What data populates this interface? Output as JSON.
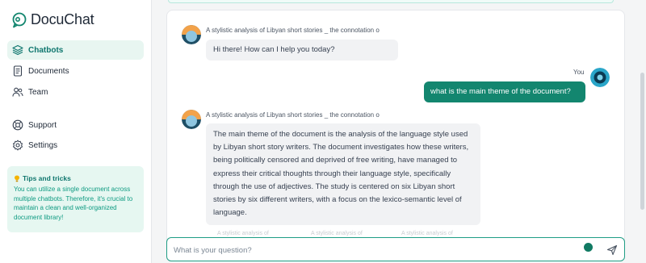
{
  "app": {
    "name": "DocuChat"
  },
  "sidebar": {
    "items": [
      {
        "label": "Chatbots",
        "icon": "layers-icon",
        "active": true
      },
      {
        "label": "Documents",
        "icon": "document-icon",
        "active": false
      },
      {
        "label": "Team",
        "icon": "team-icon",
        "active": false
      },
      {
        "label": "Support",
        "icon": "lifebuoy-icon",
        "active": false
      },
      {
        "label": "Settings",
        "icon": "gear-icon",
        "active": false
      }
    ],
    "tips": {
      "title": "Tips and tricks",
      "icon": "lightbulb-icon",
      "text": "You can utilize a single document across multiple chatbots. Therefore, it's crucial to maintain a clean and well-organized document library!"
    }
  },
  "chat": {
    "bot_name": "A stylistic analysis of Libyan short stories _ the connotation o",
    "user_name": "You",
    "messages": [
      {
        "role": "bot",
        "text": "Hi there! How can I help you today?"
      },
      {
        "role": "user",
        "text": "what is the main theme of the document?"
      },
      {
        "role": "bot",
        "text": "The main theme of the document is the analysis of the language style used by Libyan short story writers. The document investigates how these writers, being politically censored and deprived of free writing, have managed to express their critical thoughts through their language style, specifically through the use of adjectives. The study is centered on six Libyan short stories by six different writers, with a focus on the lexico-semantic level of language."
      }
    ],
    "sources": [
      "A stylistic analysis of",
      "A stylistic analysis of",
      "A stylistic analysis of"
    ],
    "input": {
      "placeholder": "What is your question?",
      "value": ""
    }
  },
  "colors": {
    "accent": "#13866f",
    "accent_light": "#e6f7f1",
    "bot_bubble": "#f1f2f4"
  }
}
